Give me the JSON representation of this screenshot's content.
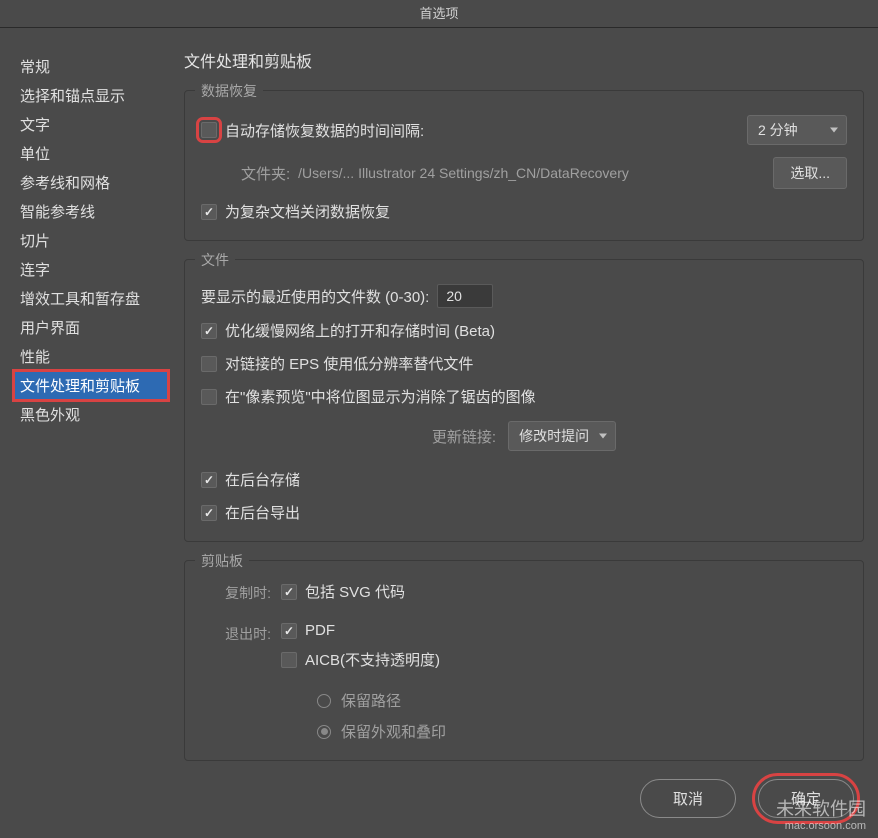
{
  "window": {
    "title": "首选项"
  },
  "sidebar": {
    "items": [
      {
        "label": "常规"
      },
      {
        "label": "选择和锚点显示"
      },
      {
        "label": "文字"
      },
      {
        "label": "单位"
      },
      {
        "label": "参考线和网格"
      },
      {
        "label": "智能参考线"
      },
      {
        "label": "切片"
      },
      {
        "label": "连字"
      },
      {
        "label": "增效工具和暂存盘"
      },
      {
        "label": "用户界面"
      },
      {
        "label": "性能"
      },
      {
        "label": "文件处理和剪贴板"
      },
      {
        "label": "黑色外观"
      }
    ],
    "selectedIndex": 11
  },
  "content": {
    "title": "文件处理和剪贴板"
  },
  "recovery": {
    "title": "数据恢复",
    "autoSaveLabel": "自动存储恢复数据的时间间隔:",
    "autoSaveChecked": false,
    "intervalValue": "2 分钟",
    "folderLabel": "文件夹:",
    "folderPath": "/Users/... Illustrator 24 Settings/zh_CN/DataRecovery",
    "chooseButton": "选取...",
    "disableComplexLabel": "为复杂文档关闭数据恢复",
    "disableComplexChecked": true
  },
  "files": {
    "title": "文件",
    "recentLabel": "要显示的最近使用的文件数 (0-30):",
    "recentValue": "20",
    "optimizeLabel": "优化缓慢网络上的打开和存储时间 (Beta)",
    "optimizeChecked": true,
    "lowResEpsLabel": "对链接的 EPS 使用低分辨率替代文件",
    "lowResEpsChecked": false,
    "pixelPreviewLabel": "在\"像素预览\"中将位图显示为消除了锯齿的图像",
    "pixelPreviewChecked": false,
    "updateLinksLabel": "更新链接:",
    "updateLinksValue": "修改时提问",
    "bgSaveLabel": "在后台存储",
    "bgSaveChecked": true,
    "bgExportLabel": "在后台导出",
    "bgExportChecked": true
  },
  "clipboard": {
    "title": "剪贴板",
    "copyLabel": "复制时:",
    "quitLabel": "退出时:",
    "svgLabel": "包括 SVG 代码",
    "svgChecked": true,
    "pdfLabel": "PDF",
    "pdfChecked": true,
    "aicbLabel": "AICB(不支持透明度)",
    "aicbChecked": false,
    "preservePathsLabel": "保留路径",
    "preserveAppearanceLabel": "保留外观和叠印",
    "radioSelected": "appearance"
  },
  "footer": {
    "cancel": "取消",
    "ok": "确定"
  },
  "watermark": {
    "main": "未来软件园",
    "sub": "mac.orsoon.com"
  }
}
